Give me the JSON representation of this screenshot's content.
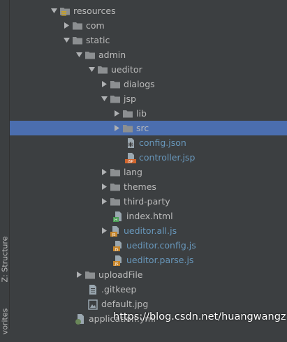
{
  "sidebar": {
    "structure_tab": "Z: Structure",
    "favorites_tab": "vorites"
  },
  "tree": {
    "top_partial_item": "",
    "items": [
      {
        "label": "resources",
        "type": "folder-resources",
        "arrow": "expanded"
      },
      {
        "label": "com",
        "type": "folder",
        "arrow": "collapsed"
      },
      {
        "label": "static",
        "type": "folder",
        "arrow": "expanded"
      },
      {
        "label": "admin",
        "type": "folder",
        "arrow": "expanded"
      },
      {
        "label": "ueditor",
        "type": "folder",
        "arrow": "expanded"
      },
      {
        "label": "dialogs",
        "type": "folder",
        "arrow": "collapsed"
      },
      {
        "label": "jsp",
        "type": "folder",
        "arrow": "expanded"
      },
      {
        "label": "lib",
        "type": "folder",
        "arrow": "collapsed"
      },
      {
        "label": "src",
        "type": "folder",
        "arrow": "collapsed",
        "selected": true
      },
      {
        "label": "config.json",
        "type": "json-file"
      },
      {
        "label": "controller.jsp",
        "type": "jsp-file"
      },
      {
        "label": "lang",
        "type": "folder",
        "arrow": "collapsed"
      },
      {
        "label": "themes",
        "type": "folder",
        "arrow": "collapsed"
      },
      {
        "label": "third-party",
        "type": "folder",
        "arrow": "collapsed"
      },
      {
        "label": "index.html",
        "type": "html-file"
      },
      {
        "label": "ueditor.all.js",
        "type": "js-file",
        "arrow": "collapsed"
      },
      {
        "label": "ueditor.config.js",
        "type": "js-file"
      },
      {
        "label": "ueditor.parse.js",
        "type": "js-file"
      },
      {
        "label": "uploadFile",
        "type": "folder",
        "arrow": "collapsed"
      },
      {
        "label": ".gitkeep",
        "type": "text-file"
      },
      {
        "label": "default.jpg",
        "type": "image-file"
      },
      {
        "label": "application.yml",
        "type": "yml-file"
      }
    ]
  },
  "watermark": "https://blog.csdn.net/huangwangz",
  "colors": {
    "background": "#3c3f41",
    "selection": "#4b6eaf",
    "text": "#bbbbbb",
    "link_text": "#6897bb",
    "folder": "#8c8f91",
    "js_badge": "#c6852b",
    "jsp_badge": "#d0652d"
  }
}
